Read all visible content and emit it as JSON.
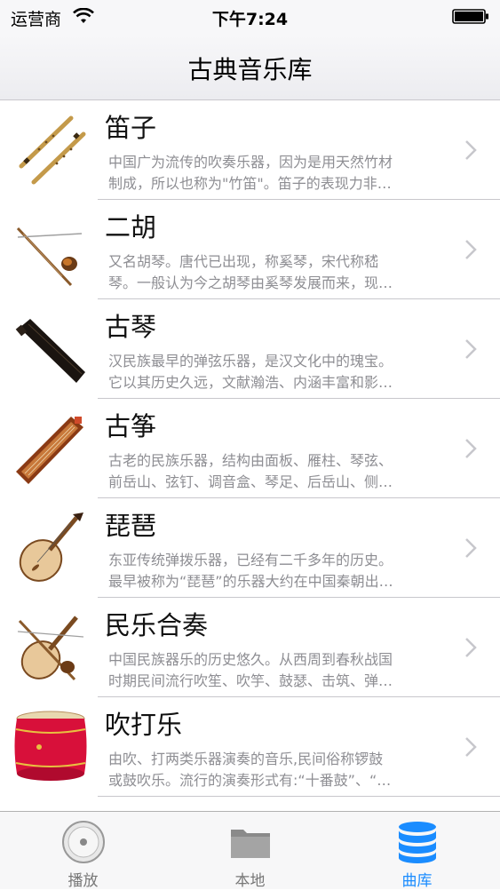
{
  "status_bar": {
    "carrier": "运营商",
    "time": "下午7:24"
  },
  "nav": {
    "title": "古典音乐库"
  },
  "items": [
    {
      "title": "笛子",
      "desc1": "中国广为流传的吹奏乐器，因为是用天然竹材",
      "desc2": "制成，所以也称为\"竹笛\"。笛子的表现力非…",
      "icon": "dizi-flute-image"
    },
    {
      "title": "二胡",
      "desc1": "又名胡琴。唐代已出现，称奚琴，宋代称嵇",
      "desc2": "琴。一般认为今之胡琴由奚琴发展而来，现…",
      "icon": "erhu-image"
    },
    {
      "title": "古琴",
      "desc1": "汉民族最早的弹弦乐器，是汉文化中的瑰宝。",
      "desc2": "它以其历史久远，文献瀚浩、内涵丰富和影…",
      "icon": "guqin-image"
    },
    {
      "title": "古筝",
      "desc1": "古老的民族乐器，结构由面板、雁柱、琴弦、",
      "desc2": "前岳山、弦钉、调音盒、琴足、后岳山、侧…",
      "icon": "guzheng-image"
    },
    {
      "title": "琵琶",
      "desc1": "东亚传统弹拨乐器，已经有二千多年的历史。",
      "desc2": "最早被称为“琵琶”的乐器大约在中国秦朝出…",
      "icon": "pipa-image"
    },
    {
      "title": "民乐合奏",
      "desc1": "中国民族器乐的历史悠久。从西周到春秋战国",
      "desc2": "时期民间流行吹笙、吹竽、鼓瑟、击筑、弹…",
      "icon": "ensemble-image"
    },
    {
      "title": "吹打乐",
      "desc1": "由吹、打两类乐器演奏的音乐,民间俗称锣鼓",
      "desc2": "或鼓吹乐。流行的演奏形式有:“十番鼓”、“…",
      "icon": "drum-image"
    }
  ],
  "tabs": [
    {
      "label": "播放",
      "icon": "play-disc-icon",
      "active": false
    },
    {
      "label": "本地",
      "icon": "folder-icon",
      "active": false
    },
    {
      "label": "曲库",
      "icon": "database-icon",
      "active": true
    }
  ],
  "colors": {
    "accent": "#1a8cff",
    "separator": "#c8c7cc",
    "desc": "#8e8e93"
  }
}
